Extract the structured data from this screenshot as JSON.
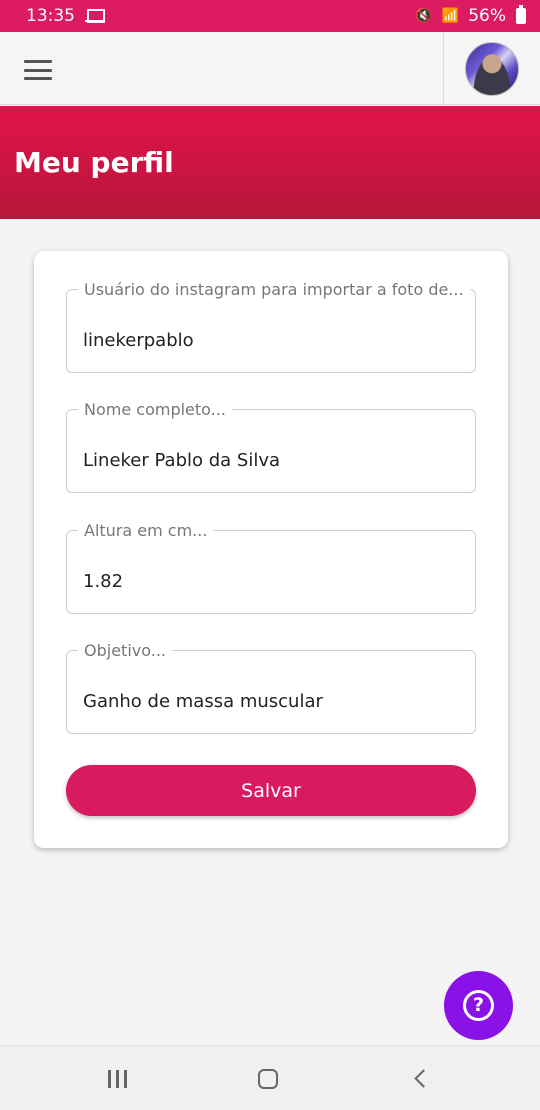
{
  "status_bar": {
    "time": "13:35",
    "battery": "56%"
  },
  "app_bar": {
    "menu_icon": "hamburger-menu-icon",
    "avatar_icon": "profile-avatar"
  },
  "header": {
    "title": "Meu perfil"
  },
  "form": {
    "fields": [
      {
        "label": "Usuário do instagram para importar a foto de...",
        "value": "linekerpablo"
      },
      {
        "label": "Nome completo...",
        "value": "Lineker Pablo da Silva"
      },
      {
        "label": "Altura em cm...",
        "value": "1.82"
      },
      {
        "label": "Objetivo...",
        "value": "Ganho de massa muscular"
      }
    ],
    "save_label": "Salvar"
  },
  "help": {
    "icon": "question-mark-icon",
    "glyph": "?"
  },
  "nav_bar": {
    "recents_icon": "recents-icon",
    "home_icon": "home-icon",
    "back_icon": "back-icon"
  },
  "colors": {
    "accent": "#dc1b60",
    "header_gradient_start": "#e0144c",
    "header_gradient_end": "#b51638",
    "save_button": "#d81a5e",
    "help_fab": "#8a12e6"
  }
}
